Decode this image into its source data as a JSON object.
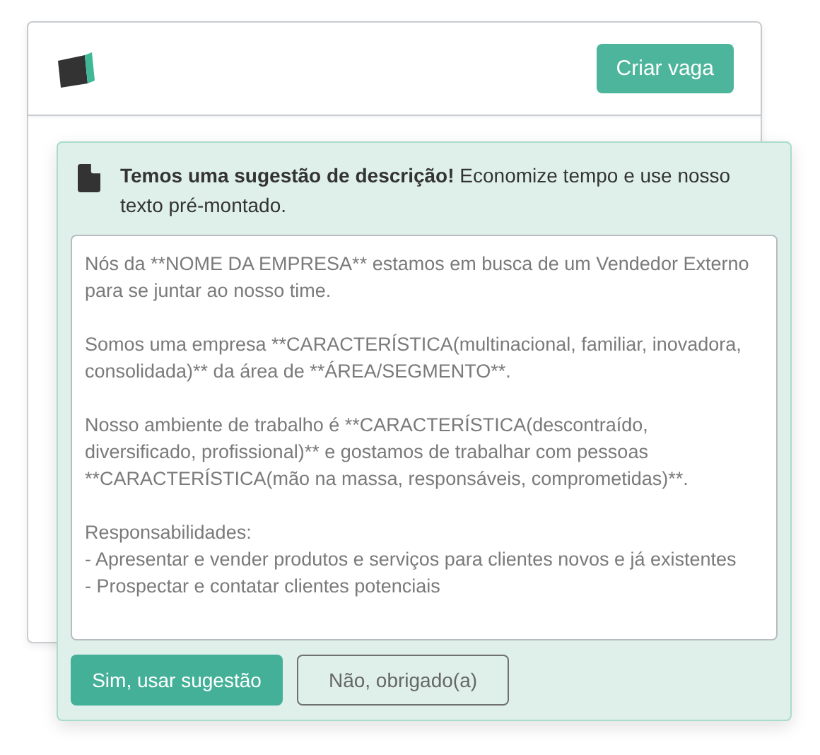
{
  "header": {
    "button": "Criar vaga"
  },
  "suggestion": {
    "message": "**Temos uma sugestão de descrição!** Economize tempo e use nosso texto pré-montado.",
    "text": "Nós da **NOME DA EMPRESA** estamos em busca de um Vendedor Externo para se juntar ao nosso time.\n\nSomos uma empresa **CARACTERÍSTICA(multinacional, familiar, inovadora, consolidada)** da área de **ÁREA/SEGMENTO**.\n\nNosso ambiente de trabalho é **CARACTERÍSTICA(descontraído, diversificado, profissional)** e gostamos de trabalhar com pessoas **CARACTERÍSTICA(mão na massa, responsáveis, comprometidas)**.\n\nResponsabilidades:\n- Apresentar e vender produtos e serviços para clientes novos e já existentes\n- Prospectar e contatar clientes potenciais",
    "buttons": [
      {
        "label": "Sim, usar sugestão",
        "kind": "primary"
      },
      {
        "label": "Não, obrigado(a)",
        "kind": "secondary"
      }
    ]
  }
}
